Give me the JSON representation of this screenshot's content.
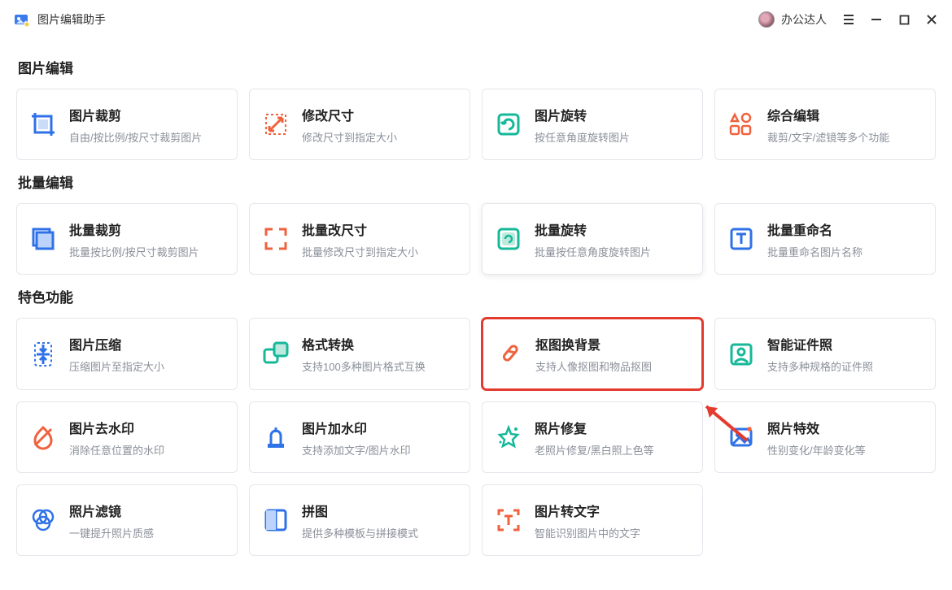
{
  "app": {
    "title": "图片编辑助手",
    "user": "办公达人"
  },
  "sections": {
    "edit": {
      "heading": "图片编辑",
      "items": [
        {
          "id": "crop",
          "title": "图片裁剪",
          "desc": "自由/按比例/按尺寸裁剪图片"
        },
        {
          "id": "resize",
          "title": "修改尺寸",
          "desc": "修改尺寸到指定大小"
        },
        {
          "id": "rotate",
          "title": "图片旋转",
          "desc": "按任意角度旋转图片"
        },
        {
          "id": "multi-edit",
          "title": "综合编辑",
          "desc": "裁剪/文字/滤镜等多个功能"
        }
      ]
    },
    "batch": {
      "heading": "批量编辑",
      "items": [
        {
          "id": "batch-crop",
          "title": "批量裁剪",
          "desc": "批量按比例/按尺寸裁剪图片"
        },
        {
          "id": "batch-resize",
          "title": "批量改尺寸",
          "desc": "批量修改尺寸到指定大小"
        },
        {
          "id": "batch-rotate",
          "title": "批量旋转",
          "desc": "批量按任意角度旋转图片"
        },
        {
          "id": "batch-rename",
          "title": "批量重命名",
          "desc": "批量重命名图片名称"
        }
      ]
    },
    "special": {
      "heading": "特色功能",
      "items": [
        {
          "id": "compress",
          "title": "图片压缩",
          "desc": "压缩图片至指定大小"
        },
        {
          "id": "convert",
          "title": "格式转换",
          "desc": "支持100多种图片格式互换"
        },
        {
          "id": "cutout",
          "title": "抠图换背景",
          "desc": "支持人像抠图和物品抠图"
        },
        {
          "id": "idphoto",
          "title": "智能证件照",
          "desc": "支持多种规格的证件照"
        },
        {
          "id": "rm-watermark",
          "title": "图片去水印",
          "desc": "消除任意位置的水印"
        },
        {
          "id": "add-watermark",
          "title": "图片加水印",
          "desc": "支持添加文字/图片水印"
        },
        {
          "id": "restore",
          "title": "照片修复",
          "desc": "老照片修复/黑白照上色等"
        },
        {
          "id": "effects",
          "title": "照片特效",
          "desc": "性别变化/年龄变化等"
        },
        {
          "id": "filter",
          "title": "照片滤镜",
          "desc": "一键提升照片质感"
        },
        {
          "id": "collage",
          "title": "拼图",
          "desc": "提供多种模板与拼接模式"
        },
        {
          "id": "ocr",
          "title": "图片转文字",
          "desc": "智能识别图片中的文字"
        }
      ]
    }
  },
  "colors": {
    "blue": "#2f72e8",
    "orange": "#f0623e",
    "teal": "#16b89a",
    "red": "#e33b2e",
    "purple": "#7a6ff0"
  }
}
